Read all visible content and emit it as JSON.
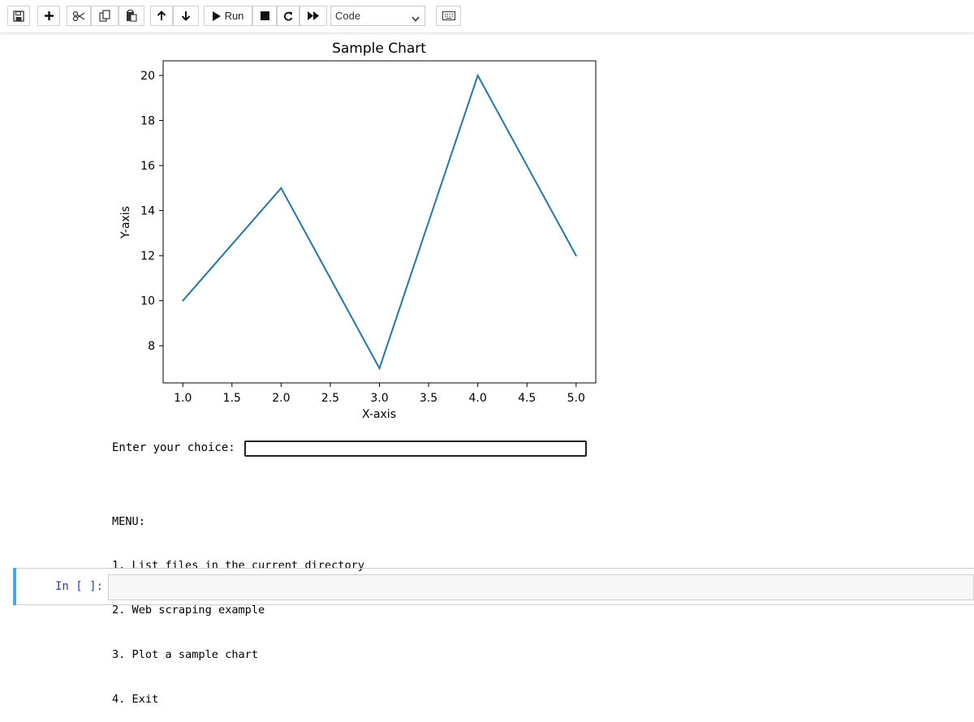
{
  "toolbar": {
    "run_label": "Run",
    "cell_type": "Code",
    "icons": [
      "save-icon",
      "add-icon",
      "cut-icon",
      "copy-icon",
      "paste-icon",
      "move-up-icon",
      "move-down-icon",
      "run-icon",
      "stop-icon",
      "restart-icon",
      "fast-forward-icon",
      "keyboard-icon"
    ]
  },
  "chart_data": {
    "type": "line",
    "title": "Sample Chart",
    "xlabel": "X-axis",
    "ylabel": "Y-axis",
    "x": [
      1,
      2,
      3,
      4,
      5
    ],
    "y": [
      10,
      15,
      7,
      20,
      12
    ],
    "xticks": [
      "1.0",
      "1.5",
      "2.0",
      "2.5",
      "3.0",
      "3.5",
      "4.0",
      "4.5",
      "5.0"
    ],
    "yticks": [
      "8",
      "10",
      "12",
      "14",
      "16",
      "18",
      "20"
    ],
    "xlim": [
      0.8,
      5.2
    ],
    "ylim": [
      6.35,
      20.65
    ],
    "grid": false,
    "line_color": "#1f77b4"
  },
  "prompt": {
    "label": "Enter your choice:",
    "value": ""
  },
  "menu": {
    "lines": [
      "MENU:",
      "1. List files in the current directory",
      "2. Web scraping example",
      "3. Plot a sample chart",
      "4. Exit"
    ]
  },
  "cell": {
    "prompt": "In [ ]:"
  }
}
